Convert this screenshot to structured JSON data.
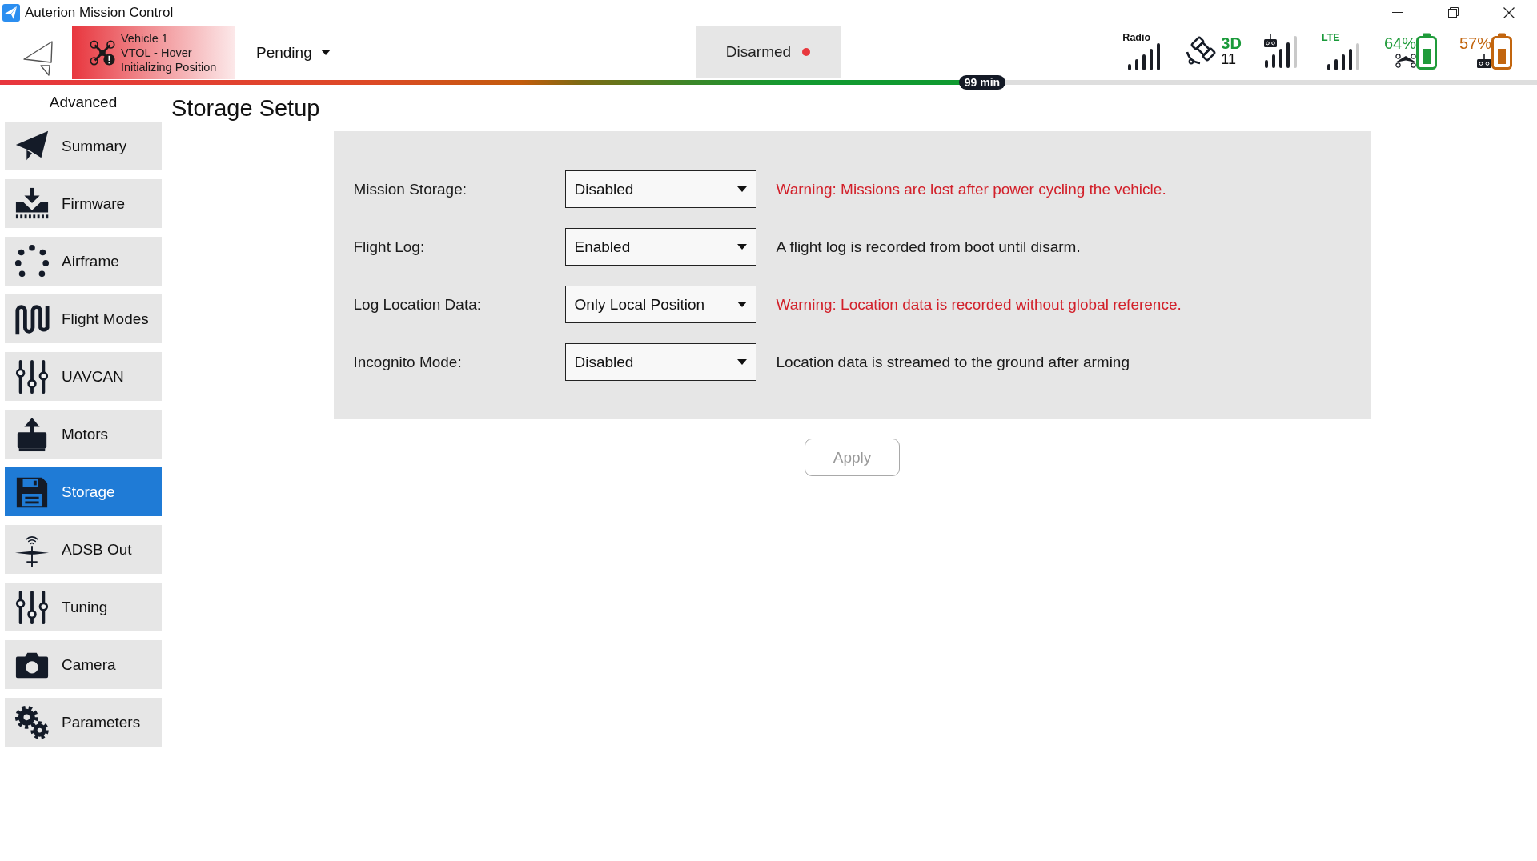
{
  "window": {
    "title": "Auterion Mission Control"
  },
  "toolbar": {
    "vehicle": {
      "name": "Vehicle 1",
      "type": "VTOL - Hover",
      "status": "Initializing Position"
    },
    "flight_mode": "Pending",
    "arming": {
      "label": "Disarmed",
      "armed": false
    },
    "flight_time": {
      "label": "99 min",
      "level": 0.64
    }
  },
  "status_indicators": {
    "radio": {
      "label": "Radio"
    },
    "gps": {
      "fix": "3D",
      "satellites": "11"
    },
    "lte": {
      "label": "LTE"
    },
    "batteries": [
      {
        "kind": "vehicle",
        "percent": "64%",
        "color": "#1f9b3a"
      },
      {
        "kind": "remote",
        "percent": "57%",
        "color": "#c2650e"
      }
    ]
  },
  "sidebar": {
    "heading": "Advanced",
    "items": [
      {
        "label": "Summary",
        "selected": false
      },
      {
        "label": "Firmware",
        "selected": false
      },
      {
        "label": "Airframe",
        "selected": false
      },
      {
        "label": "Flight Modes",
        "selected": false
      },
      {
        "label": "UAVCAN",
        "selected": false
      },
      {
        "label": "Motors",
        "selected": false
      },
      {
        "label": "Storage",
        "selected": true
      },
      {
        "label": "ADSB Out",
        "selected": false
      },
      {
        "label": "Tuning",
        "selected": false
      },
      {
        "label": "Camera",
        "selected": false
      },
      {
        "label": "Parameters",
        "selected": false
      }
    ]
  },
  "page": {
    "title": "Storage Setup",
    "settings": [
      {
        "label": "Mission Storage:",
        "value": "Disabled",
        "note": "Warning: Missions are lost after power cycling the vehicle.",
        "warning": true
      },
      {
        "label": "Flight Log:",
        "value": "Enabled",
        "note": "A flight log is recorded from boot until disarm.",
        "warning": false
      },
      {
        "label": "Log Location Data:",
        "value": "Only Local Position",
        "note": "Warning: Location data is recorded without global reference.",
        "warning": true
      },
      {
        "label": "Incognito Mode:",
        "value": "Disabled",
        "note": "Location data is streamed to the ground after arming",
        "warning": false
      }
    ],
    "apply_button": {
      "label": "Apply",
      "disabled": true
    }
  }
}
